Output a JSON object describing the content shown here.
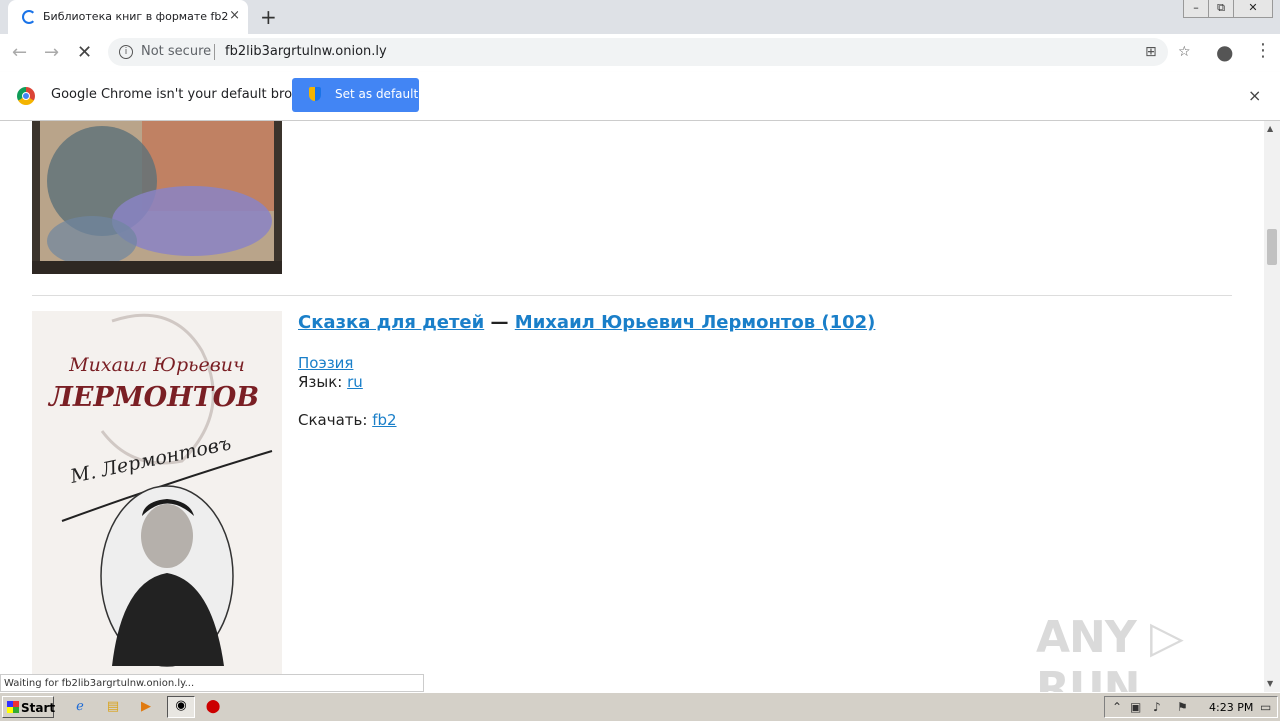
{
  "browser": {
    "tab_title": "Библиотека книг в формате fb2",
    "tab_close": "×",
    "new_tab": "+",
    "not_secure": "Not secure",
    "url": "fb2lib3argrtulnw.onion.ly",
    "window_controls": {
      "minimize": "–",
      "restore": "⧉",
      "close": "✕"
    }
  },
  "infobar": {
    "message": "Google Chrome isn't your default browser",
    "button_label": "Set as default",
    "close": "×"
  },
  "book": {
    "title": "Сказка для детей",
    "dash": "—",
    "author": "Михаил Юрьевич Лермонтов (102)",
    "genre": "Поэзия",
    "language_label": "Язык: ",
    "language": "ru",
    "download_label": "Скачать: ",
    "download_format": "fb2",
    "cover_author_first": "Михаил Юрьевич",
    "cover_author_last": "ЛЕРМОНТОВ",
    "cover_signature": "М. Лермонтовъ"
  },
  "status_text": "Waiting for fb2lib3argrtulnw.onion.ly...",
  "watermark": "ANY ▷ RUN",
  "taskbar": {
    "start_label": "Start",
    "clock": "4:23 PM"
  }
}
